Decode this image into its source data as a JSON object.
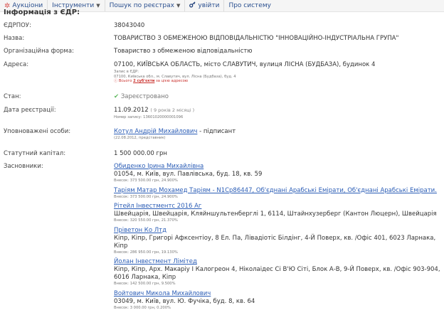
{
  "menu": {
    "items": [
      {
        "label": "Аукціони",
        "icon": "gear-icon"
      },
      {
        "label": "Інструменти",
        "dropdown": true
      },
      {
        "label": "Пошук по реєстрах",
        "dropdown": true
      },
      {
        "label": "увійти",
        "icon": "key-icon"
      },
      {
        "label": "Про систему"
      }
    ],
    "caret": "▼",
    "gear_glyph": "✲",
    "key_glyph": "🔑"
  },
  "section_title": "Інформація з ЄДР:",
  "fields": {
    "edrpou": {
      "label": "ЄДРПОУ:",
      "value": "38043040"
    },
    "name": {
      "label": "Назва:",
      "value": "ТОВАРИСТВО З ОБМЕЖЕНОЮ ВІДПОВІДАЛЬНІСТЮ \"ІННОВАЦІЙНО-ІНДУСТРІАЛЬНА ГРУПА\""
    },
    "org_form": {
      "label": "Організаційна форма:",
      "value": "Товариство з обмеженою відповідальністю"
    },
    "address": {
      "label": "Адреса:",
      "value": "07100, КИЇВСЬКА ОБЛАСТЬ, місто СЛАВУТИЧ, вулиця ЛІСНА (БУДБАЗА), будинок 4",
      "note1": "Запис в ЄДР:",
      "note2": "07100, Київська обл., м. Славутич, вул. Лісна (Будбаза), буд. 4",
      "warn_prefix": "Всього",
      "warn_link": "2 суб'єкти",
      "warn_suffix": "за цією адресою"
    },
    "status": {
      "label": "Стан:",
      "value": "Зареєстровано",
      "check": "✔"
    },
    "reg_date": {
      "label": "Дата реєстрації:",
      "value": "11.09.2012",
      "duration": "( 9 років 2 місяці )",
      "record_prefix": "Номер запису:",
      "record_no": "13601020000001096"
    },
    "authorized": {
      "label": "Уповноважені особи:",
      "person": "Котул Андрій Михайлович",
      "role": " - підписант",
      "note": "(22.08.2012, представник)"
    },
    "capital": {
      "label": "Статутний капітал:",
      "value": "1 500 000.00 грн"
    },
    "founders_label": "Засновники:"
  },
  "founders": [
    {
      "name": "Обиденко Ірина Михайлівна",
      "addr": "01054, м. Київ, вул. Павлівська, буд. 18, кв. 59",
      "sum": "Внесок: 373 500.00 грн, 24.900%"
    },
    {
      "name": "Таріям Матар Мохамед Таріям - N1Cp86447, Об'єднані Арабські Емірати, Об'єднані Арабські Емірати.",
      "addr": "",
      "sum": "Внесок: 373 500.00 грн, 24.900%"
    },
    {
      "name": "Рітейл Інвестментс 2016 Аг",
      "addr": "Швейцарія, Швейцарія, Кляйншультенберглі 1, 6114, Штайнхузерберг (Кантон Люцерн), Швейцарія",
      "sum": "Внесок: 320 550.00 грн, 21.370%"
    },
    {
      "name": "Пріветон Ко Лтд",
      "addr": "Кіпр, Кіпр, Григорі Афксентіоу, 8 Ел. Па, Лівадіотіс Білдінг, 4-Й Поверх, кв. /Офіс 401, 6023 Ларнака, Кіпр",
      "sum": "Внесок: 286 950.00 грн, 19.130%"
    },
    {
      "name": "Йолан Інвестмент Лімітед",
      "addr": "Кіпр, Кіпр, Арх. Макаріу І Калогреон 4, Ніколаідес Сі В'Ю Сіті, Блок А-В, 9-Й Поверх, кв. /Офіс 903-904, 6016 Ларнака, Кіпр",
      "sum": "Внесок: 142 500.00 грн, 9.500%"
    },
    {
      "name": "Войтович Микола Михайлович",
      "addr": "03049, м. Київ, вул. Ю. Фучіка, буд. 8, кв. 64",
      "sum": "Внесок: 3 000.00 грн, 0.200%"
    }
  ]
}
